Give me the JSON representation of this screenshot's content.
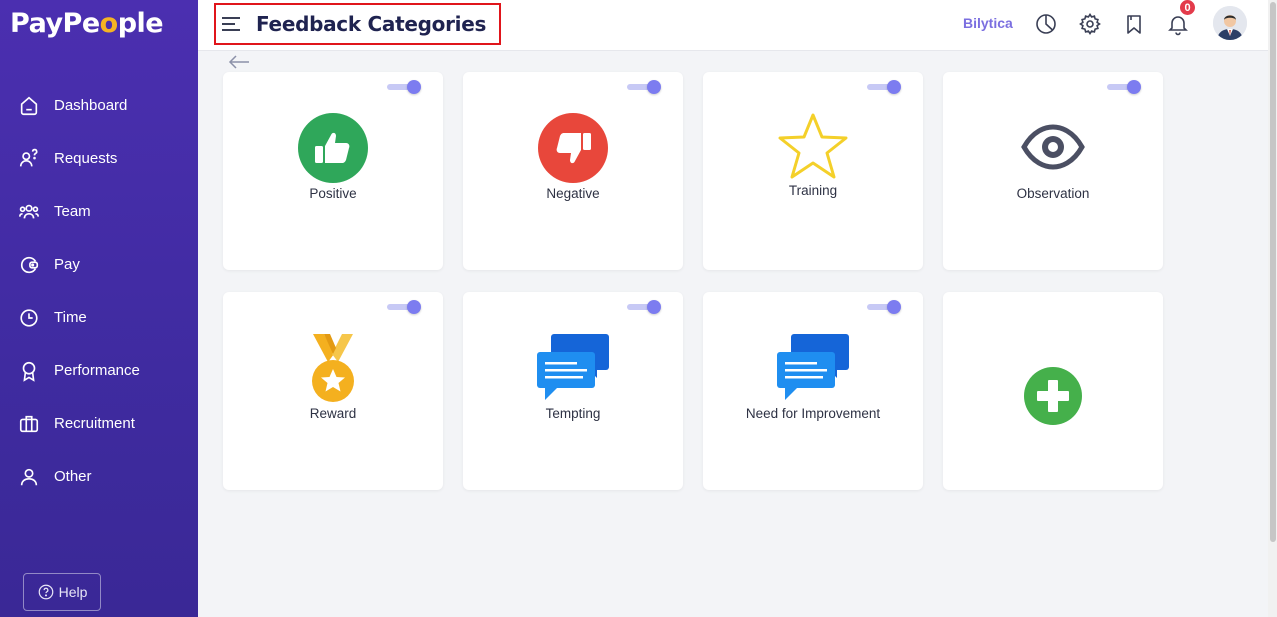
{
  "app": {
    "logo_prefix": "PayPe",
    "logo_o": "o",
    "logo_suffix": "ple",
    "brand": "Bilytica"
  },
  "header": {
    "title": "Feedback Categories",
    "notification_count": "0"
  },
  "sidebar": {
    "items": [
      {
        "label": "Dashboard",
        "icon": "home-icon"
      },
      {
        "label": "Requests",
        "icon": "requests-icon"
      },
      {
        "label": "Team",
        "icon": "team-icon"
      },
      {
        "label": "Pay",
        "icon": "wallet-icon"
      },
      {
        "label": "Time",
        "icon": "clock-icon"
      },
      {
        "label": "Performance",
        "icon": "award-icon"
      },
      {
        "label": "Recruitment",
        "icon": "briefcase-icon"
      },
      {
        "label": "Other",
        "icon": "user-icon"
      }
    ],
    "help_label": "Help"
  },
  "categories": [
    {
      "label": "Positive",
      "icon": "thumbs-up-icon",
      "enabled": true,
      "color": "#2fa75a"
    },
    {
      "label": "Negative",
      "icon": "thumbs-down-icon",
      "enabled": true,
      "color": "#e8473b"
    },
    {
      "label": "Training",
      "icon": "star-icon",
      "enabled": true,
      "color": "#f4d02a"
    },
    {
      "label": "Observation",
      "icon": "eye-icon",
      "enabled": true,
      "color": "#4b4f63"
    },
    {
      "label": "Reward",
      "icon": "medal-icon",
      "enabled": true,
      "color": "#f4b01f"
    },
    {
      "label": "Tempting",
      "icon": "chat-bubbles-icon",
      "enabled": true,
      "color": "#1f8ef0"
    },
    {
      "label": "Need for Improvement",
      "icon": "chat-bubbles-icon",
      "enabled": true,
      "color": "#1f8ef0"
    }
  ],
  "add_card": {
    "icon": "plus-icon",
    "color": "#45b04b"
  },
  "colors": {
    "sidebar": "#4b2fb0",
    "accent": "#7c7cf0",
    "title": "#1f2350",
    "highlight_border": "#e0151b"
  }
}
